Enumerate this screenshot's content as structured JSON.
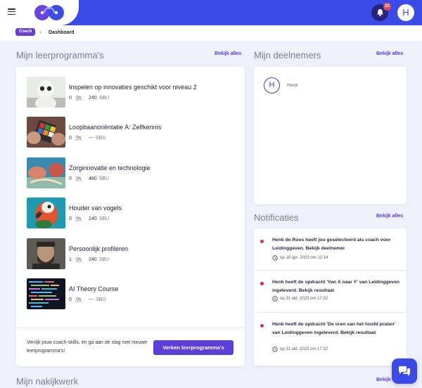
{
  "header": {
    "notification_count": "22",
    "user_initial": "H"
  },
  "breadcrumb": {
    "role": "Coach",
    "current": "Dashboard"
  },
  "programs_section": {
    "title": "Mijn leerprogramma's",
    "view_all": "Bekijk alles",
    "items": [
      {
        "title": "Inspelen op innovaties geschikt voor niveau 2",
        "participants": "0",
        "sbu": "240",
        "sbu_unit": "SBU",
        "image": "robot"
      },
      {
        "title": "Loopbaanoriëntatie A: Zelfkennis",
        "participants": "0",
        "sbu": "---",
        "sbu_unit": "SBU",
        "image": "rubiks-cube"
      },
      {
        "title": "Zorginnovatie en technologie",
        "participants": "0",
        "sbu": "480",
        "sbu_unit": "SBU",
        "image": "hands-craft"
      },
      {
        "title": "Houder van vogels",
        "participants": "0",
        "sbu": "240",
        "sbu_unit": "SBU",
        "image": "parrot"
      },
      {
        "title": "Persoonlijk profileren",
        "participants": "1",
        "sbu": "240",
        "sbu_unit": "SBU",
        "image": "portrait"
      },
      {
        "title": "AI Theory Course",
        "participants": "0",
        "sbu": "---",
        "sbu_unit": "SBU",
        "image": "code-screen"
      }
    ],
    "footer_text": "Verrijk jouw coach-skills, en ga aan de slag met nieuwe leerprogramma's!",
    "footer_button": "Verken leerprogramma's"
  },
  "participants_section": {
    "title": "Mijn deelnemers",
    "view_all": "Bekijk alles",
    "members": [
      {
        "initial": "H",
        "name": "Henk"
      }
    ]
  },
  "notifications_section": {
    "title": "Notificaties",
    "view_all": "Bekijk alles",
    "items": [
      {
        "text": "Henk de Roos heeft jou geselecteerd als coach voor Leidinggeven. Bekijk deelnemer",
        "time": "op 18 apr. 2023 om 12:14"
      },
      {
        "text": "Henk heeft de opdracht 'Van X naar Y' van Leidinggeven ingeleverd. Bekijk resultaat",
        "time": "op 31 okt. 2023 om 17:22"
      },
      {
        "text": "Henk heeft de opdracht 'De oren van het hoofd praten' van Leidinggeven ingeleverd. Bekijk resultaat",
        "time": "op 31 okt. 2023 om 17:22"
      }
    ]
  },
  "grading_section": {
    "title": "Mijn nakijkwerk",
    "view_all": "Bekijk alles"
  },
  "colors": {
    "brand": "#3b4be6",
    "accent": "#5b3fd6",
    "badge": "#e5484d",
    "unread_dot": "#c5334f"
  }
}
